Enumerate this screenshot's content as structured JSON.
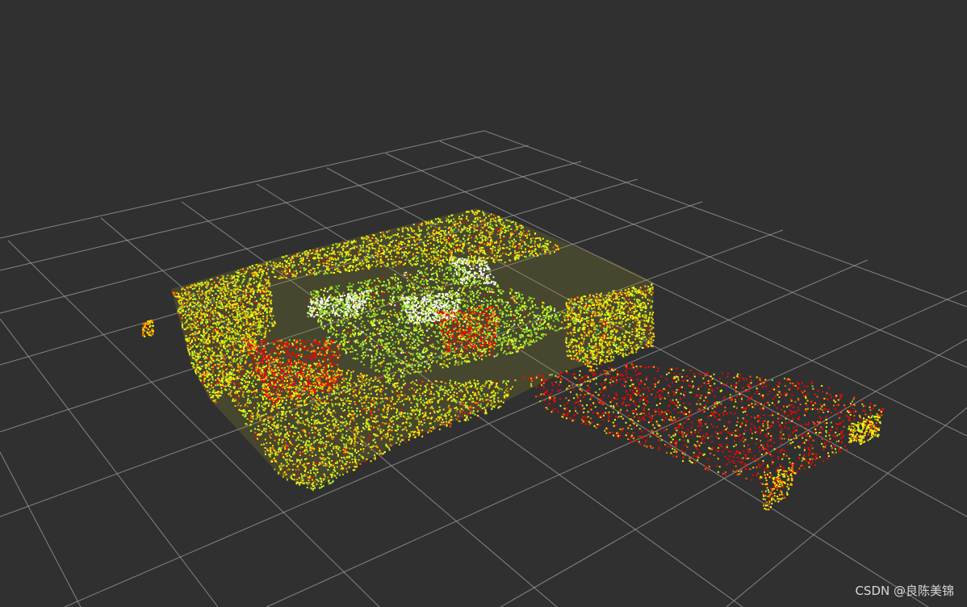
{
  "view": {
    "background_color": "#303030",
    "grid_color": "#a0a0a0",
    "grid_visible": true,
    "cloud_colors": [
      "#ff0000",
      "#ff6600",
      "#ffcc00",
      "#ffff00",
      "#ccff33",
      "#88dd22",
      "#ffffff"
    ]
  },
  "watermark": {
    "text": "CSDN @良陈美锦"
  }
}
